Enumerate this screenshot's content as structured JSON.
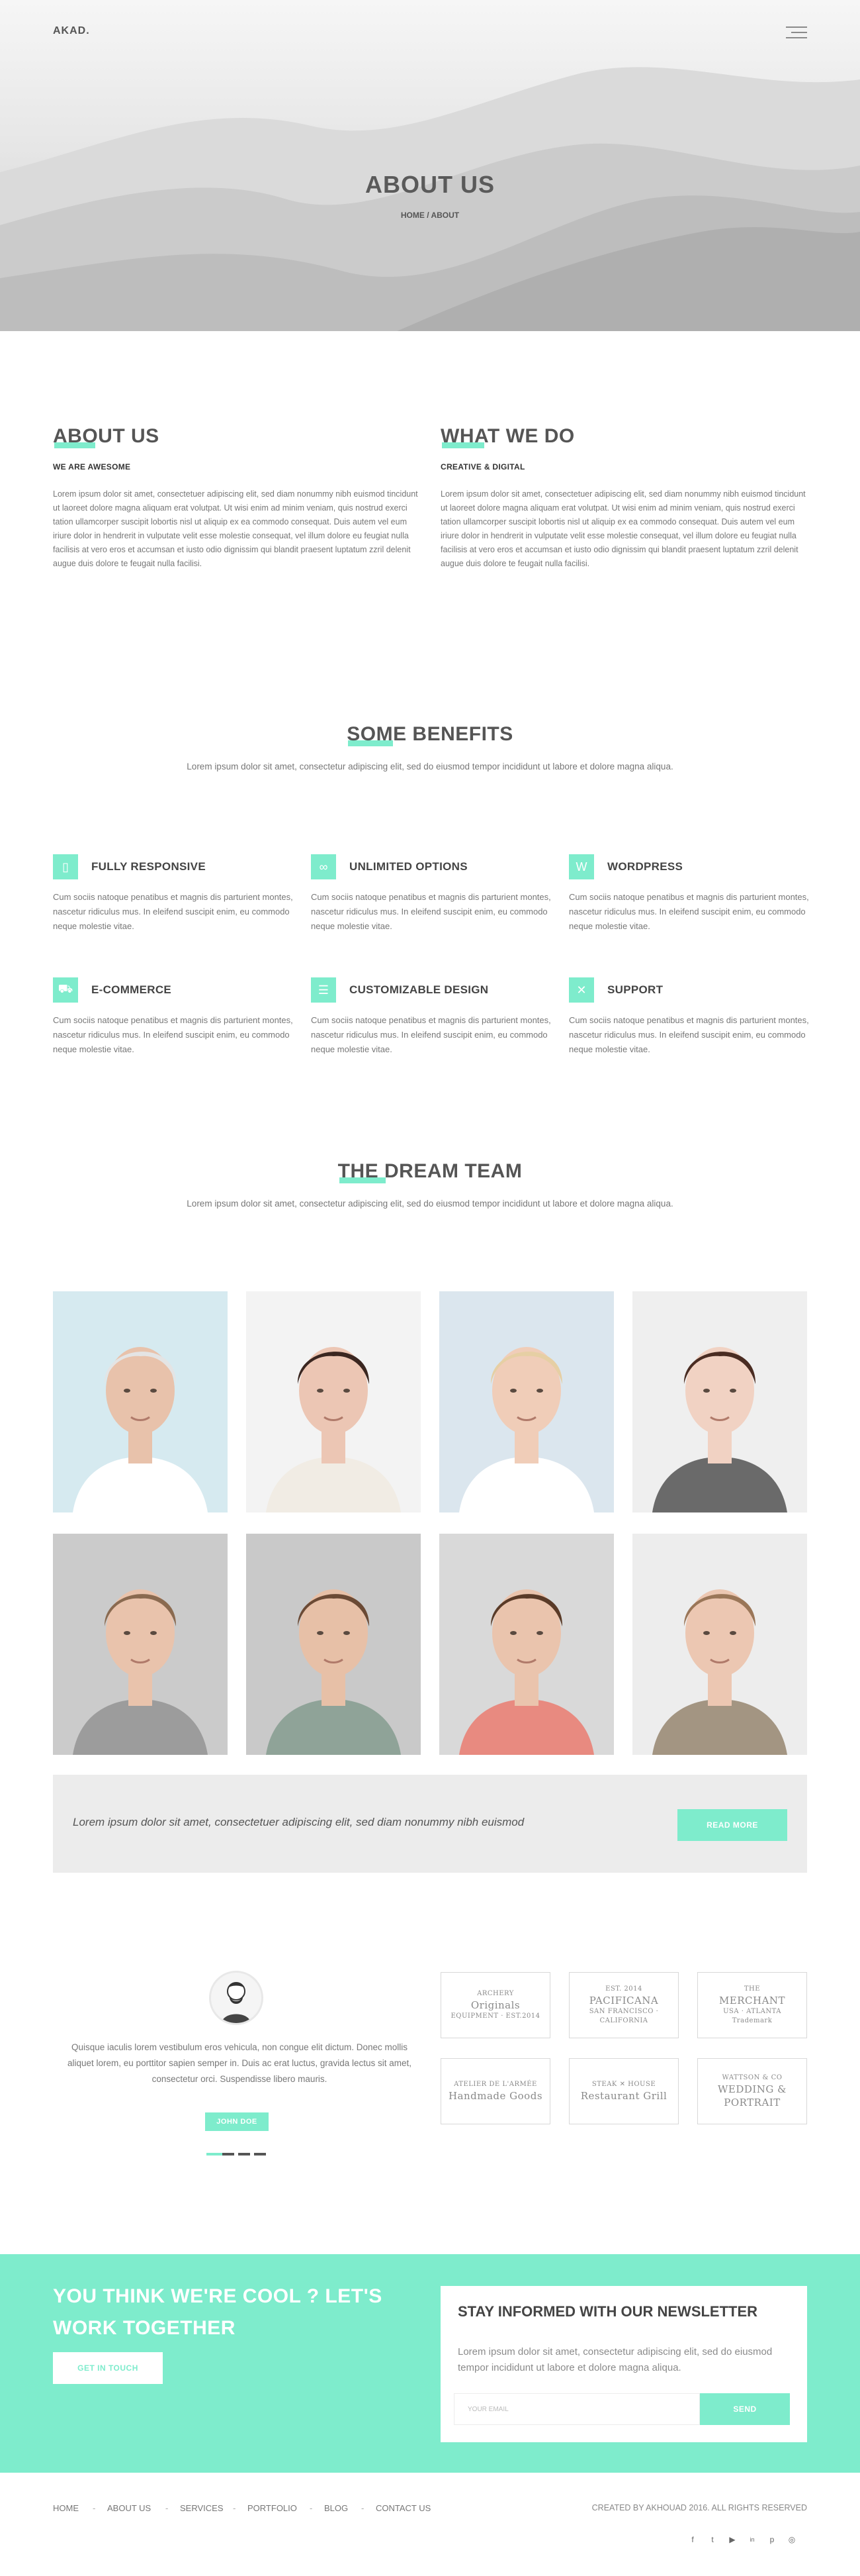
{
  "header": {
    "logo": "AKAD.",
    "menu_icon": "hamburger-menu-icon",
    "hero_title": "ABOUT US",
    "breadcrumb": {
      "home": "HOME",
      "separator": " / ",
      "current": "ABOUT"
    }
  },
  "about": {
    "title": "ABOUT US",
    "subtitle": "WE ARE AWESOME",
    "text": "Lorem ipsum dolor sit amet, consectetuer adipiscing elit, sed diam nonummy nibh euismod tincidunt ut laoreet dolore magna aliquam erat volutpat. Ut wisi enim ad minim veniam, quis nostrud exerci tation ullamcorper suscipit lobortis nisl ut aliquip ex ea commodo consequat. Duis autem vel eum iriure dolor in hendrerit in vulputate velit esse molestie consequat, vel illum dolore eu feugiat nulla facilisis at vero eros et accumsan et iusto odio dignissim qui blandit praesent luptatum zzril delenit augue duis dolore te feugait nulla facilisi."
  },
  "what_we_do": {
    "title": "WHAT WE DO",
    "subtitle": "CREATIVE & DIGITAL",
    "text": "Lorem ipsum dolor sit amet, consectetuer adipiscing elit, sed diam nonummy nibh euismod tincidunt ut laoreet dolore magna aliquam erat volutpat. Ut wisi enim ad minim veniam, quis nostrud exerci tation ullamcorper suscipit lobortis nisl ut aliquip ex ea commodo consequat. Duis autem vel eum iriure dolor in hendrerit in vulputate velit esse molestie consequat, vel illum dolore eu feugiat nulla facilisis at vero eros et accumsan et iusto odio dignissim qui blandit praesent luptatum zzril delenit augue duis dolore te feugait nulla facilisi."
  },
  "benefits": {
    "title": "SOME BENEFITS",
    "intro": "Lorem ipsum dolor sit amet, consectetur adipiscing elit, sed do eiusmod tempor incididunt ut labore et dolore magna aliqua.",
    "items": [
      {
        "title": "FULLY RESPONSIVE",
        "icon": "mobile-icon",
        "glyph": "▯",
        "text": "Cum sociis natoque penatibus et magnis dis parturient montes, nascetur ridiculus mus. In eleifend suscipit enim, eu commodo neque molestie vitae."
      },
      {
        "title": "UNLIMITED OPTIONS",
        "icon": "infinity-icon",
        "glyph": "∞",
        "text": "Cum sociis natoque penatibus et magnis dis parturient montes, nascetur ridiculus mus. In eleifend suscipit enim, eu commodo neque molestie vitae."
      },
      {
        "title": "WORDPRESS",
        "icon": "wordpress-icon",
        "glyph": "W",
        "text": "Cum sociis natoque penatibus et magnis dis parturient montes, nascetur ridiculus mus. In eleifend suscipit enim, eu commodo neque molestie vitae."
      },
      {
        "title": "E-COMMERCE",
        "icon": "shopping-cart-icon",
        "glyph": "⛟",
        "text": "Cum sociis natoque penatibus et magnis dis parturient montes, nascetur ridiculus mus. In eleifend suscipit enim, eu commodo neque molestie vitae."
      },
      {
        "title": "CUSTOMIZABLE DESIGN",
        "icon": "layout-icon",
        "glyph": "☰",
        "text": "Cum sociis natoque penatibus et magnis dis parturient montes, nascetur ridiculus mus. In eleifend suscipit enim, eu commodo neque molestie vitae."
      },
      {
        "title": "SUPPORT",
        "icon": "tools-icon",
        "glyph": "✕",
        "text": "Cum sociis natoque penatibus et magnis dis parturient montes, nascetur ridiculus mus. In eleifend suscipit enim, eu commodo neque molestie vitae."
      }
    ]
  },
  "team": {
    "title": "THE DREAM TEAM",
    "intro": "Lorem ipsum dolor sit amet, consectetur adipiscing elit, sed do eiusmod tempor incididunt ut labore et dolore magna aliqua.",
    "members": [
      {
        "bg": "#d6eaf0",
        "hair": "#e4e4e4",
        "skin": "#e8c2ab",
        "shirt": "#ffffff"
      },
      {
        "bg": "#f3f3f3",
        "hair": "#3a2620",
        "skin": "#ecc6b4",
        "shirt": "#f1ece4"
      },
      {
        "bg": "#dbe6ee",
        "hair": "#e6cfa4",
        "skin": "#f0cdb8",
        "shirt": "#ffffff"
      },
      {
        "bg": "#efefef",
        "hair": "#4a2c22",
        "skin": "#f1d2c3",
        "shirt": "#6a6a6a"
      },
      {
        "bg": "#cbcbcb",
        "hair": "#8a6a50",
        "skin": "#e9c3ac",
        "shirt": "#9c9c9c"
      },
      {
        "bg": "#c9c9c9",
        "hair": "#6b4a35",
        "skin": "#e7c0a7",
        "shirt": "#8fa398"
      },
      {
        "bg": "#d9d9d9",
        "hair": "#5a3b28",
        "skin": "#eac4ad",
        "shirt": "#e88a80"
      },
      {
        "bg": "#ededed",
        "hair": "#9a7658",
        "skin": "#ecc7b2",
        "shirt": "#a39582"
      }
    ]
  },
  "quote_bar": {
    "text": "Lorem ipsum dolor sit amet, consectetuer adipiscing elit, sed diam nonummy nibh euismod",
    "button": "READ MORE"
  },
  "testimonial": {
    "avatar_icon": "avatar-icon",
    "text": "Quisque iaculis lorem vestibulum eros vehicula, non congue elit dictum. Donec mollis aliquet lorem, eu porttitor sapien semper in. Duis ac erat luctus, gravida lectus sit amet, consectetur orci. Suspendisse libero mauris.",
    "author": "JOHN DOE",
    "dots": 4,
    "active_dot": 0
  },
  "clients": [
    {
      "lines": [
        "ARCHERY",
        "Originals",
        "EQUIPMENT · EST.2014"
      ]
    },
    {
      "lines": [
        "EST. 2014",
        "PACIFICANA",
        "SAN FRANCISCO · CALIFORNIA"
      ]
    },
    {
      "lines": [
        "THE",
        "MERCHANT",
        "USA · ATLANTA",
        "Trademark"
      ]
    },
    {
      "lines": [
        "ATELIER DE L'ARMÉE",
        "Handmade Goods"
      ]
    },
    {
      "lines": [
        "STEAK ✕ HOUSE",
        "Restaurant Grill"
      ]
    },
    {
      "lines": [
        "WATTSON & CO",
        "WEDDING & PORTRAIT"
      ]
    }
  ],
  "cta": {
    "title": "YOU THINK WE'RE COOL ? LET'S WORK TOGETHER",
    "button": "GET IN TOUCH",
    "accent": "#7eeccc"
  },
  "newsletter": {
    "title": "STAY INFORMED WITH OUR NEWSLETTER",
    "text": "Lorem ipsum dolor sit amet, consectetur adipiscing elit, sed do eiusmod tempor incididunt ut labore et dolore magna aliqua.",
    "placeholder": "YOUR EMAIL",
    "button": "SEND"
  },
  "footer": {
    "nav": [
      "HOME",
      "ABOUT US",
      "SERVICES",
      "PORTFOLIO",
      "BLOG",
      "CONTACT US"
    ],
    "separator": "-",
    "copyright": "CREATED BY AKHOUAD 2016. ALL RIGHTS RESERVED",
    "social": [
      {
        "icon": "facebook-icon",
        "glyph": "f"
      },
      {
        "icon": "twitter-icon",
        "glyph": "t"
      },
      {
        "icon": "youtube-icon",
        "glyph": "▶"
      },
      {
        "icon": "linkedin-icon",
        "glyph": "in"
      },
      {
        "icon": "pinterest-icon",
        "glyph": "p"
      },
      {
        "icon": "instagram-icon",
        "glyph": "◎"
      }
    ]
  }
}
